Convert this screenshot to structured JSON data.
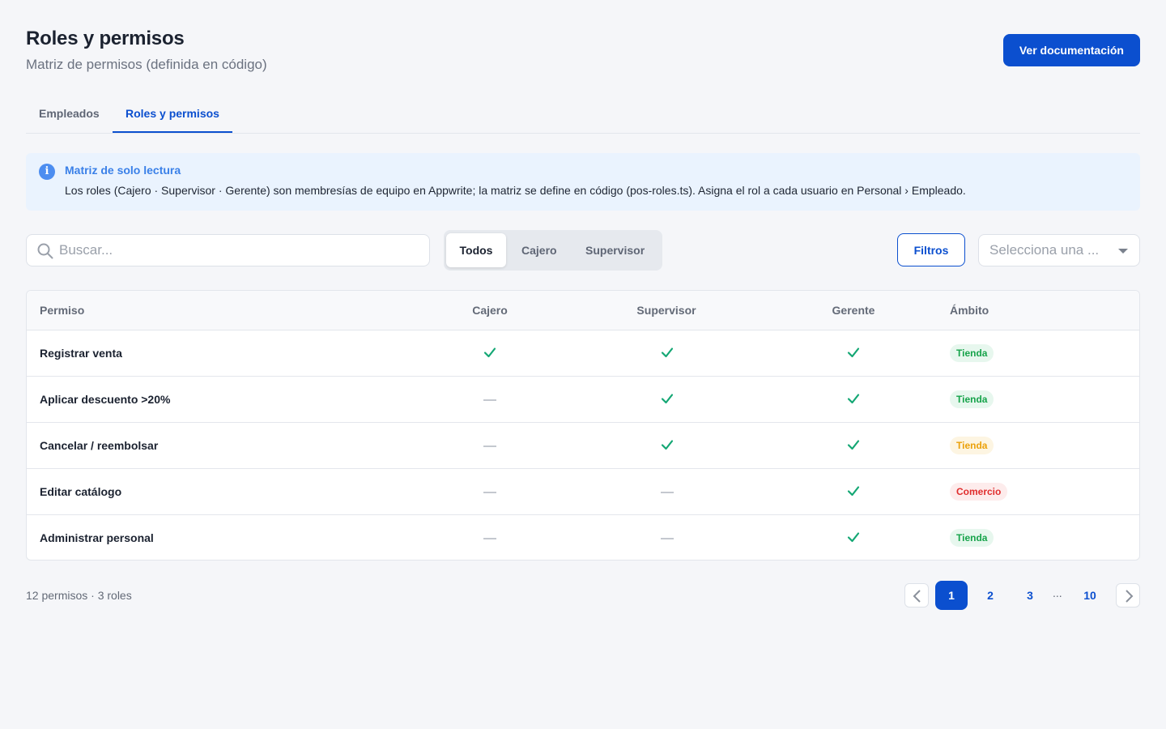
{
  "header": {
    "title": "Roles y permisos",
    "subtitle": "Matriz de permisos (definida en código)",
    "doc_button": "Ver documentación"
  },
  "tabs": [
    {
      "label": "Empleados",
      "active": false
    },
    {
      "label": "Roles y permisos",
      "active": true
    }
  ],
  "info": {
    "icon": "info-icon",
    "title": "Matriz de solo lectura",
    "text": "Los roles (Cajero · Supervisor · Gerente) son membresías de equipo en Appwrite; la matriz se define en código (pos-roles.ts). Asigna el rol a cada usuario en Personal › Empleado."
  },
  "toolbar": {
    "search_placeholder": "Buscar...",
    "segments": [
      {
        "label": "Todos",
        "active": true
      },
      {
        "label": "Cajero",
        "active": false
      },
      {
        "label": "Supervisor",
        "active": false
      }
    ],
    "filters_label": "Filtros",
    "select_placeholder": "Selecciona una ..."
  },
  "table": {
    "columns": [
      "Permiso",
      "Cajero",
      "Supervisor",
      "Gerente",
      "Ámbito"
    ],
    "rows": [
      {
        "permiso": "Registrar venta",
        "cajero": true,
        "supervisor": true,
        "gerente": true,
        "ambito": "Tienda",
        "ambito_color": "#16a34a",
        "ambito_bg": "#e7f7ee"
      },
      {
        "permiso": "Aplicar descuento >20%",
        "cajero": false,
        "supervisor": true,
        "gerente": true,
        "ambito": "Tienda",
        "ambito_color": "#16a34a",
        "ambito_bg": "#e7f7ee"
      },
      {
        "permiso": "Cancelar / reembolsar",
        "cajero": false,
        "supervisor": true,
        "gerente": true,
        "ambito": "Tienda",
        "ambito_color": "#eba10a",
        "ambito_bg": "#fdf5e2"
      },
      {
        "permiso": "Editar catálogo",
        "cajero": false,
        "supervisor": false,
        "gerente": true,
        "ambito": "Comercio",
        "ambito_color": "#e02d2d",
        "ambito_bg": "#fdecec"
      },
      {
        "permiso": "Administrar personal",
        "cajero": false,
        "supervisor": false,
        "gerente": true,
        "ambito": "Tienda",
        "ambito_color": "#16a34a",
        "ambito_bg": "#e7f7ee"
      }
    ],
    "check_color": "#14a774"
  },
  "footer": {
    "summary": "12 permisos · 3 roles",
    "pages": [
      "1",
      "2",
      "3",
      "10"
    ],
    "ellipsis": "...",
    "current_page": "1"
  },
  "colors": {
    "accent": "#0b4fcf",
    "info_bg": "#eaf3fe",
    "info_accent": "#3a80e8"
  }
}
